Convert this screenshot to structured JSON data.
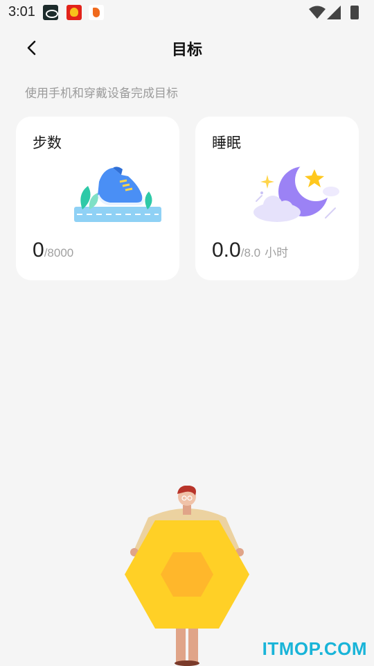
{
  "status_bar": {
    "time": "3:01",
    "notifications": [
      "app-notification-icon",
      "lion-app-notification-icon",
      "shrimp-app-notification-icon"
    ],
    "icons": [
      "wifi-icon",
      "signal-icon",
      "battery-charging-icon"
    ]
  },
  "header": {
    "title": "目标",
    "back_icon": "chevron-left-icon"
  },
  "subtitle": "使用手机和穿戴设备完成目标",
  "cards": {
    "steps": {
      "title": "步数",
      "value": "0",
      "goal": "/8000",
      "illustration": "sneaker-illustration"
    },
    "sleep": {
      "title": "睡眠",
      "value": "0.0",
      "goal": "/8.0",
      "unit": "小时",
      "illustration": "moon-star-cloud-illustration"
    }
  },
  "watermark": "ITMOP.COM",
  "colors": {
    "background": "#f5f5f5",
    "card": "#ffffff",
    "moon": "#9b82f5",
    "star": "#ffc81e",
    "shoe": "#4a8ff5",
    "leaf": "#2ec9a7",
    "watermark": "#19b4d8"
  }
}
